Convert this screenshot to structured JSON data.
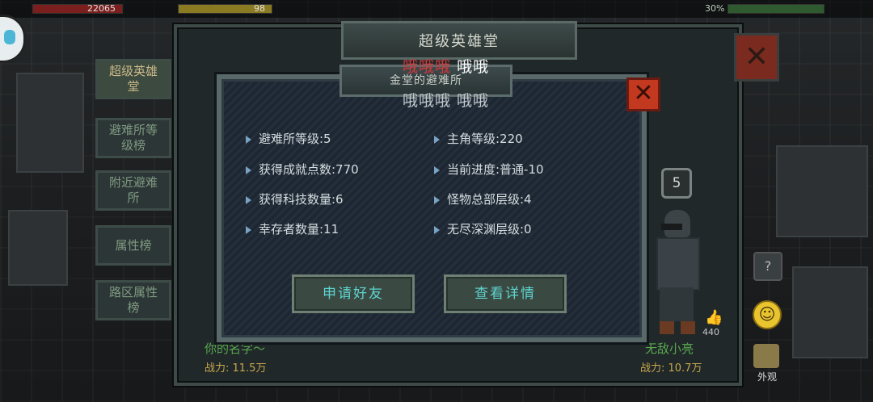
{
  "hud": {
    "hp_value": "22065",
    "exp_value": "98",
    "resource_value": "30%"
  },
  "hall": {
    "title": "超级英雄堂",
    "close_symbol": "✕",
    "tabs": [
      {
        "label": "超级英雄堂"
      },
      {
        "label": "避难所等级榜"
      },
      {
        "label": "附近避难所"
      },
      {
        "label": "属性榜"
      },
      {
        "label": "路区属性榜"
      }
    ],
    "left_player": {
      "name": "你的名字～",
      "power": "战力: 11.5万"
    },
    "right_player": {
      "name": "无敌小亮",
      "power": "战力: 10.7万",
      "level": "5",
      "likes": "440"
    },
    "help_symbol": "?",
    "look_label": "外观"
  },
  "dialog": {
    "title": "金堂的避难所",
    "chat_top_red": "哦哦哦",
    "chat_top_white": "哦哦",
    "chat_bottom": "哦哦哦 哦哦",
    "close_symbol": "✕",
    "stats_left": [
      "避难所等级:5",
      "获得成就点数:770",
      "获得科技数量:6",
      "幸存者数量:11"
    ],
    "stats_right": [
      "主角等级:220",
      "当前进度:普通-10",
      "怪物总部层级:4",
      "无尽深渊层级:0"
    ],
    "add_friend_button": "申请好友",
    "view_details_button": "查看详情"
  }
}
